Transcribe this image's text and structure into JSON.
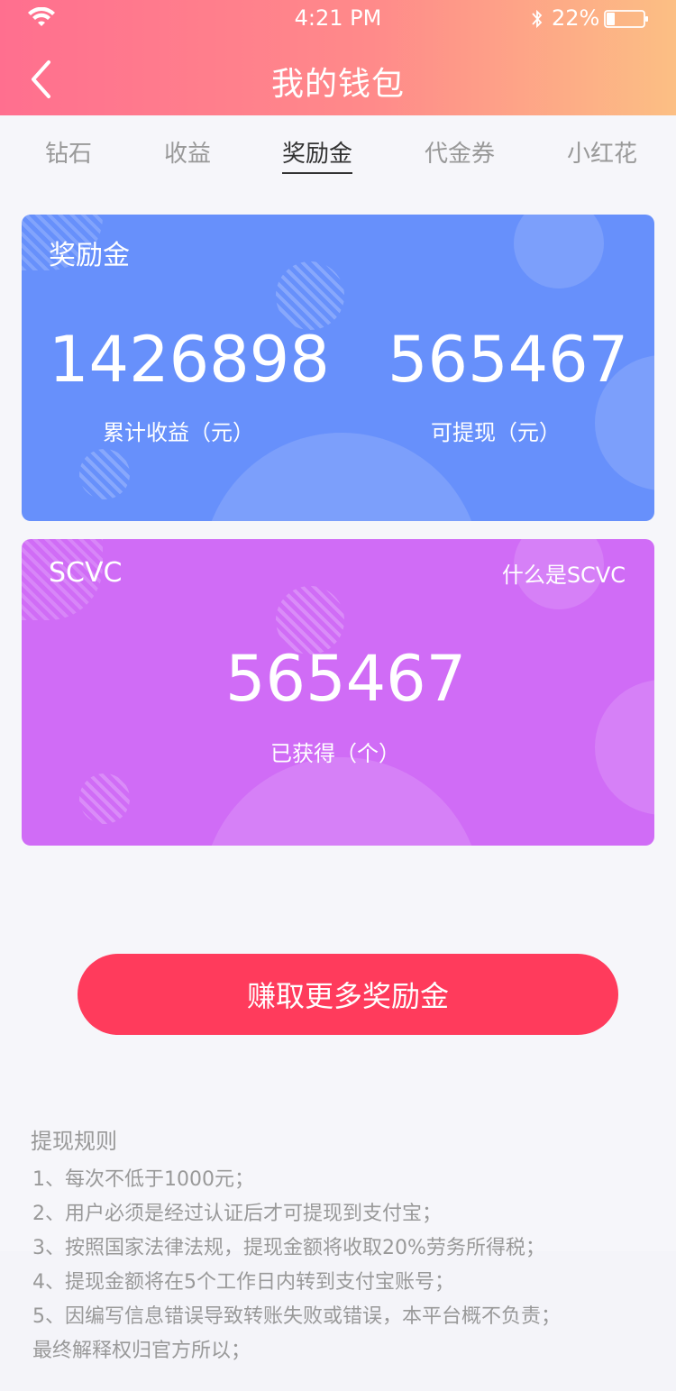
{
  "status_bar": {
    "time": "4:21 PM",
    "battery": "22%",
    "icons": [
      "wifi-icon",
      "bluetooth-icon",
      "battery-icon"
    ]
  },
  "nav": {
    "title": "我的钱包",
    "back_icon": "chevron-left-icon"
  },
  "tabs": [
    {
      "label": "钻石",
      "active": false
    },
    {
      "label": "收益",
      "active": false
    },
    {
      "label": "奖励金",
      "active": true
    },
    {
      "label": "代金券",
      "active": false
    },
    {
      "label": "小红花",
      "active": false
    }
  ],
  "reward_card": {
    "title": "奖励金",
    "total": {
      "value": "1426898",
      "label": "累计收益（元）"
    },
    "withdrawable": {
      "value": "565467",
      "label": "可提现（元）"
    }
  },
  "scvc_card": {
    "title": "SCVC",
    "help_link": "什么是SCVC",
    "obtained": {
      "value": "565467",
      "label": "已获得（个）"
    }
  },
  "earn_button": "赚取更多奖励金",
  "rules": {
    "title": "提现规则",
    "items": [
      "1、每次不低于1000元；",
      "2、用户必须是经过认证后才可提现到支付宝；",
      "3、按照国家法律法规，提现金额将收取20%劳务所得税；",
      "4、提现金额将在5个工作日内转到支付宝账号；",
      "5、因编写信息错误导致转账失败或错误，本平台概不负责；",
      "最终解释权归官方所以；"
    ]
  },
  "colors": {
    "header_start": "#ff6f8f",
    "header_end": "#fcbf84",
    "tab_inactive": "#999999",
    "tab_active": "#333333",
    "reward_card": "#6790fb",
    "scvc_card": "#d06cf6",
    "earn_button": "#ff3b5c",
    "rules_text": "#999999"
  }
}
